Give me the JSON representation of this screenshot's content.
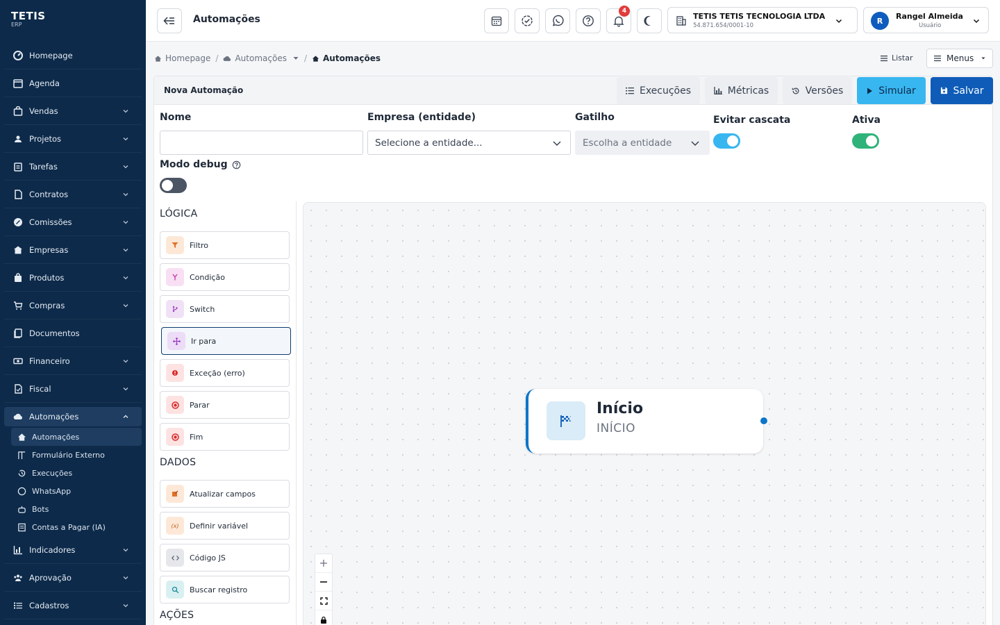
{
  "brand": {
    "name": "TETIS",
    "sub": "ERP"
  },
  "sidebar": {
    "items": [
      {
        "label": "Homepage"
      },
      {
        "label": "Agenda"
      },
      {
        "label": "Vendas"
      },
      {
        "label": "Projetos"
      },
      {
        "label": "Tarefas"
      },
      {
        "label": "Contratos"
      },
      {
        "label": "Comissões"
      },
      {
        "label": "Empresas"
      },
      {
        "label": "Produtos"
      },
      {
        "label": "Compras"
      },
      {
        "label": "Documentos"
      },
      {
        "label": "Financeiro"
      },
      {
        "label": "Fiscal"
      },
      {
        "label": "Automações"
      },
      {
        "label": "Indicadores"
      },
      {
        "label": "Aprovação"
      },
      {
        "label": "Cadastros"
      }
    ],
    "subitems": [
      {
        "label": "Automações"
      },
      {
        "label": "Formulário Externo"
      },
      {
        "label": "Execuções"
      },
      {
        "label": "WhatsApp"
      },
      {
        "label": "Bots"
      },
      {
        "label": "Contas a Pagar (IA)"
      }
    ]
  },
  "topbar": {
    "title": "Automações",
    "notification_count": "4",
    "company_name": "TETIS TETIS TECNOLOGIA LTDA",
    "company_cnpj": "54.871.654/0001-10",
    "user_initial": "R",
    "user_name": "Rangel Almeida",
    "user_role": "Usuário"
  },
  "breadcrumb": {
    "home": "Homepage",
    "section": "Automações",
    "current": "Automações"
  },
  "actions": {
    "list": "Listar",
    "menus": "Menus"
  },
  "form": {
    "title": "Nova Automação",
    "buttons": {
      "executions": "Execuções",
      "metrics": "Métricas",
      "versions": "Versões",
      "simulate": "Simular",
      "save": "Salvar"
    },
    "name_label": "Nome",
    "name_value": "",
    "company_label": "Empresa (entidade)",
    "company_value": "Selecione a entidade...",
    "trigger_label": "Gatilho",
    "trigger_value": "Escolha a entidade",
    "cascade_label": "Evitar cascata",
    "active_label": "Ativa",
    "debug_label": "Modo debug",
    "cascade_on": true,
    "active_on": true,
    "debug_on": false
  },
  "palette": {
    "logic_title": "LÓGICA",
    "logic": [
      {
        "label": "Filtro"
      },
      {
        "label": "Condição"
      },
      {
        "label": "Switch"
      },
      {
        "label": "Ir para"
      },
      {
        "label": "Exceção (erro)"
      },
      {
        "label": "Parar"
      },
      {
        "label": "Fim"
      }
    ],
    "data_title": "DADOS",
    "data": [
      {
        "label": "Atualizar campos"
      },
      {
        "label": "Definir variável"
      },
      {
        "label": "Código JS"
      },
      {
        "label": "Buscar registro"
      }
    ],
    "actions_title": "AÇÕES"
  },
  "canvas": {
    "node_title": "Início",
    "node_subtitle": "INÍCIO"
  },
  "colors": {
    "sidebar": "#0d2a4a",
    "primary": "#0e5cb8",
    "simulate": "#38b6f0",
    "toggle_on_blue": "#38b6f0",
    "toggle_on_green": "#2fb37a",
    "node_accent": "#0e76c8"
  }
}
